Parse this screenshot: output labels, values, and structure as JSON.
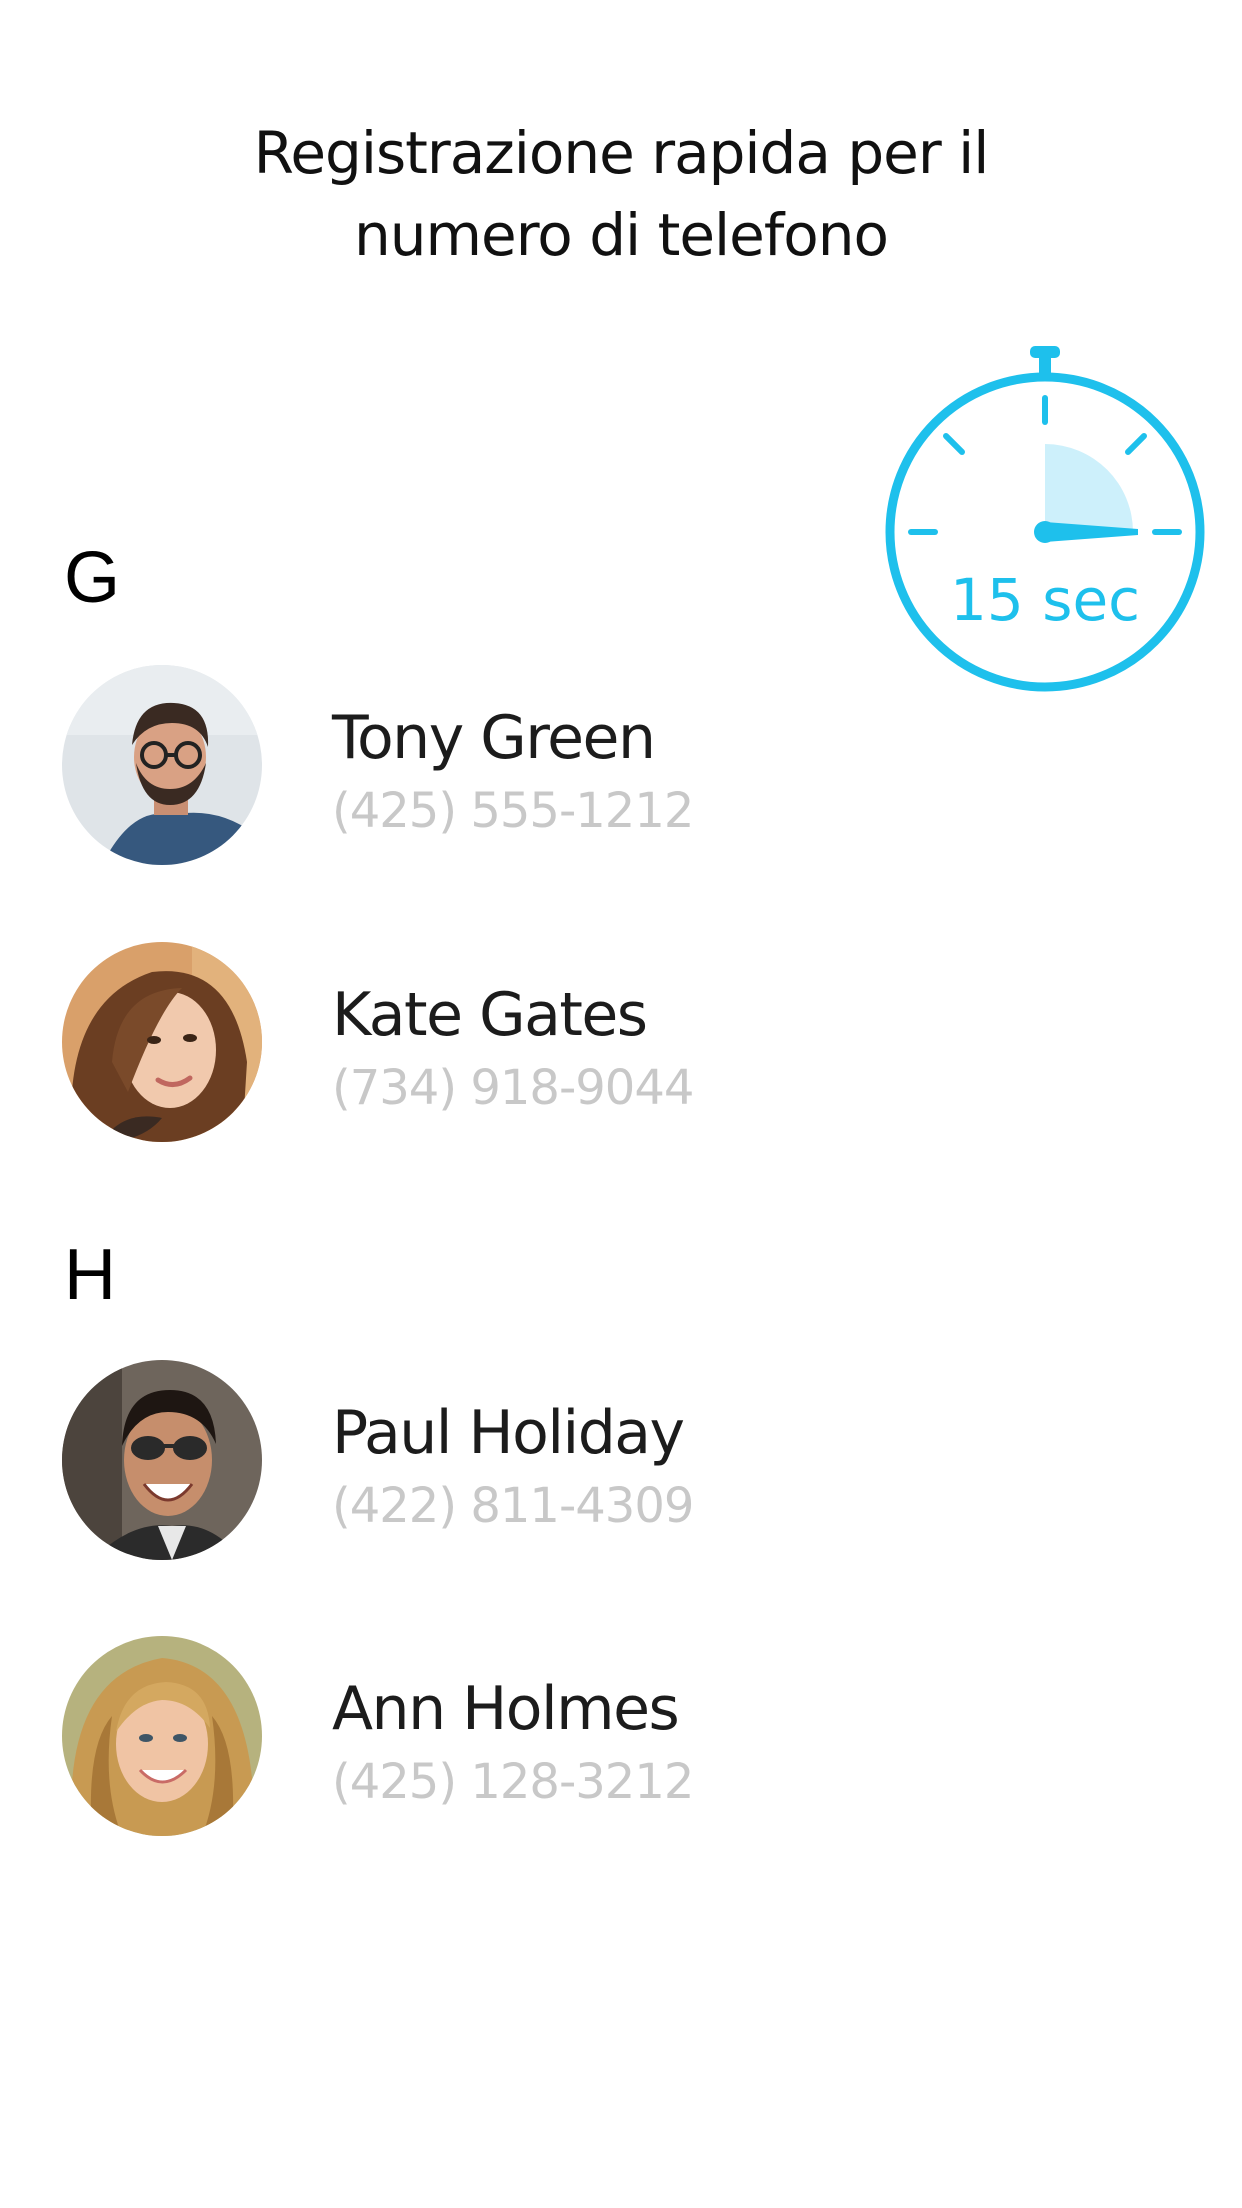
{
  "headline": {
    "line1": "Registrazione rapida per il",
    "line2": "numero di telefono"
  },
  "timer": {
    "label": "15 sec",
    "icon": "stopwatch-icon",
    "accent_color": "#1ec0ec",
    "fill_color": "#cdf0fb"
  },
  "sections": [
    {
      "letter": "G",
      "contacts": [
        {
          "name": "Tony Green",
          "phone": "(425) 555-1212",
          "avatar": "avatar-photo"
        },
        {
          "name": "Kate Gates",
          "phone": "(734) 918-9044",
          "avatar": "avatar-photo"
        }
      ]
    },
    {
      "letter": "H",
      "contacts": [
        {
          "name": "Paul Holiday",
          "phone": "(422) 811-4309",
          "avatar": "avatar-photo"
        },
        {
          "name": "Ann Holmes",
          "phone": "(425) 128-3212",
          "avatar": "avatar-photo"
        }
      ]
    }
  ],
  "colors": {
    "name_text": "#1c1c1c",
    "phone_text": "#c8c8c8",
    "background": "#ffffff"
  }
}
